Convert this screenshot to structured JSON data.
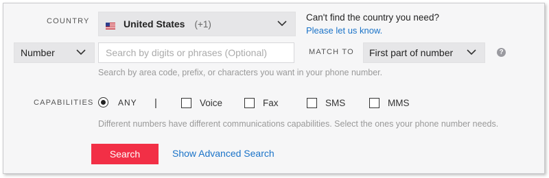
{
  "country": {
    "label": "COUNTRY",
    "selected": "United States",
    "dial_code": "(+1)",
    "flag": "us-flag-icon",
    "help_text": "Can't find the country you need?",
    "help_link": "Please let us know."
  },
  "search": {
    "type_selected": "Number",
    "placeholder": "Search by digits or phrases (Optional)",
    "match_label": "MATCH TO",
    "match_selected": "First part of number",
    "hint": "Search by area code, prefix, or characters you want in your phone number."
  },
  "capabilities": {
    "label": "CAPABILITIES",
    "any_label": "ANY",
    "separator": "|",
    "options": [
      "Voice",
      "Fax",
      "SMS",
      "MMS"
    ],
    "hint": "Different numbers have different communications capabilities. Select the ones your phone number needs."
  },
  "actions": {
    "search_label": "Search",
    "advanced_label": "Show Advanced Search"
  },
  "colors": {
    "accent": "#f22f46",
    "link": "#1a73c8"
  }
}
